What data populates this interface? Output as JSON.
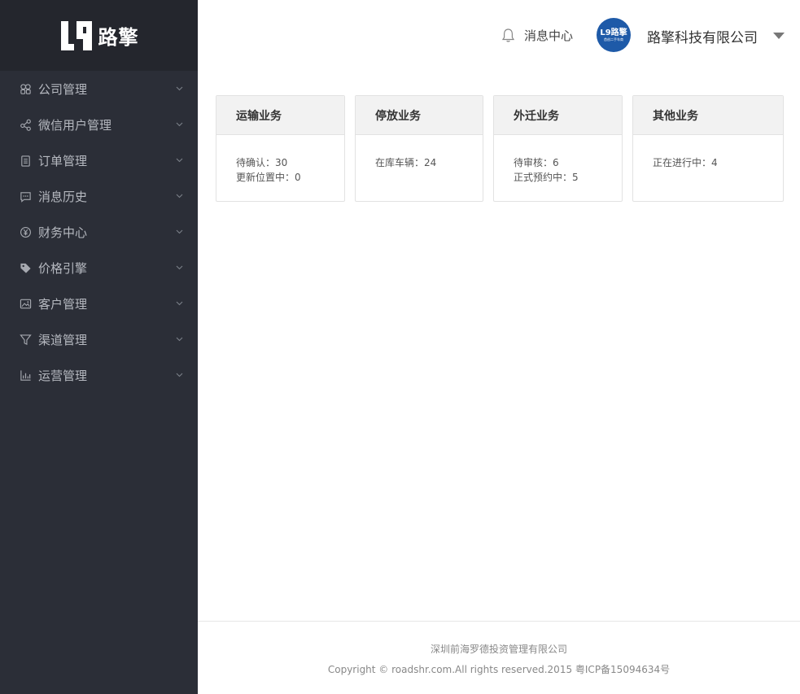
{
  "brand": {
    "logo_text": "路擎"
  },
  "sidebar": {
    "items": [
      {
        "label": "公司管理",
        "icon": "building-icon"
      },
      {
        "label": "微信用户管理",
        "icon": "share-icon"
      },
      {
        "label": "订单管理",
        "icon": "clipboard-icon"
      },
      {
        "label": "消息历史",
        "icon": "chat-icon"
      },
      {
        "label": "财务中心",
        "icon": "yen-icon"
      },
      {
        "label": "价格引擎",
        "icon": "tag-icon"
      },
      {
        "label": "客户管理",
        "icon": "image-icon"
      },
      {
        "label": "渠道管理",
        "icon": "funnel-icon"
      },
      {
        "label": "运营管理",
        "icon": "bar-chart-icon"
      }
    ]
  },
  "header": {
    "message_center": "消息中心",
    "avatar": {
      "main": "L9路擎",
      "sub": "首创二手车商"
    },
    "company_name": "路擎科技有限公司"
  },
  "cards": [
    {
      "title": "运输业务",
      "rows": [
        "待确认：30",
        "更新位置中：0"
      ]
    },
    {
      "title": "停放业务",
      "rows": [
        "在库车辆：24"
      ]
    },
    {
      "title": "外迁业务",
      "rows": [
        "待审核：6",
        "正式预约中：5"
      ]
    },
    {
      "title": "其他业务",
      "rows": [
        "正在进行中：4"
      ]
    }
  ],
  "footer": {
    "company": "深圳前海罗德投资管理有限公司",
    "copyright": "Copyright © roadshr.com.All rights reserved.2015 粤ICP备15094634号"
  },
  "colors": {
    "sidebar_bg": "#2b2e37",
    "logo_bar_bg": "#24262d",
    "avatar_bg": "#1e5aa8",
    "card_head_bg": "#f2f2f2"
  }
}
